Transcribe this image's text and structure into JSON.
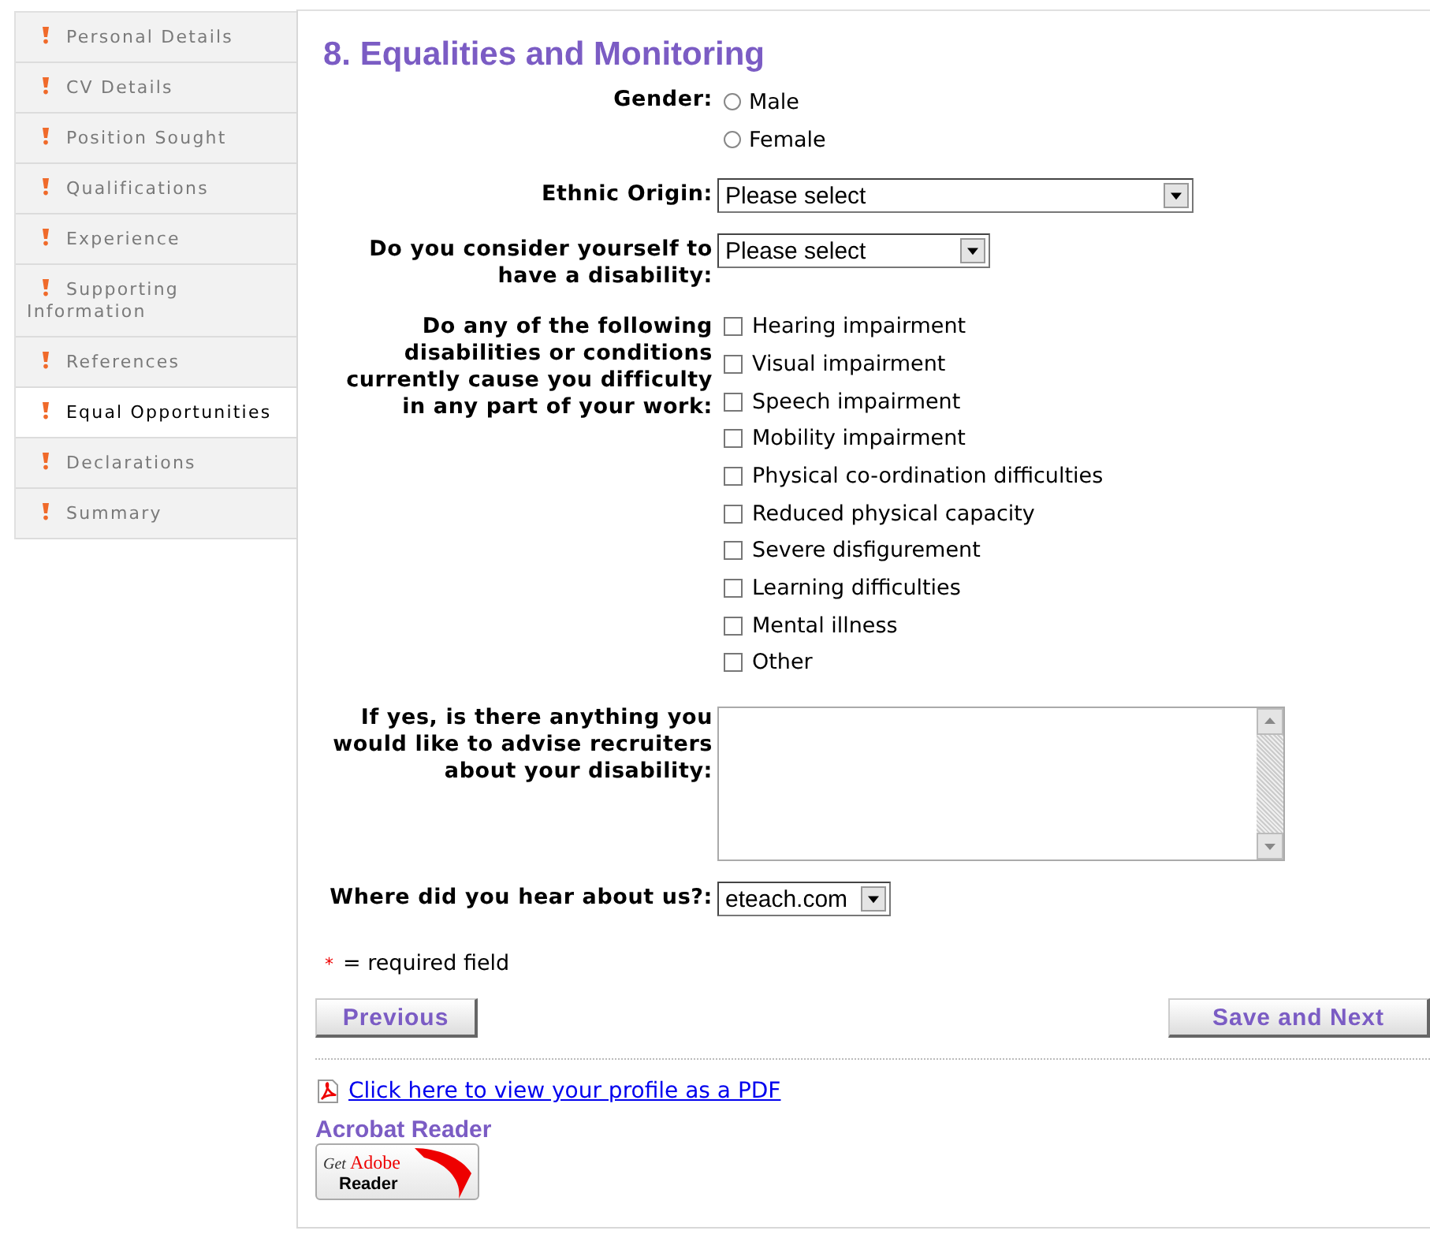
{
  "sidebar": {
    "items": [
      {
        "label": "Personal Details",
        "selected": false
      },
      {
        "label": "CV Details",
        "selected": false
      },
      {
        "label": "Position Sought",
        "selected": false
      },
      {
        "label": "Qualifications",
        "selected": false
      },
      {
        "label": "Experience",
        "selected": false
      },
      {
        "label": "Supporting Information",
        "selected": false
      },
      {
        "label": "References",
        "selected": false
      },
      {
        "label": "Equal Opportunities",
        "selected": true
      },
      {
        "label": "Declarations",
        "selected": false
      },
      {
        "label": "Summary",
        "selected": false
      }
    ]
  },
  "title": "8. Equalities and Monitoring",
  "fields": [
    {
      "kind": "radio",
      "label": "Gender:",
      "options": [
        {
          "label": "Male",
          "selected": false
        },
        {
          "label": "Female",
          "selected": false
        }
      ]
    },
    {
      "kind": "select",
      "label": "Ethnic Origin:",
      "value": "Please select"
    },
    {
      "kind": "select",
      "label": "Do you consider yourself to have a disability:",
      "value": "Please select"
    },
    {
      "kind": "checkboxes",
      "label": "Do any of the following disabilities or conditions currently cause you difficulty in any part of your work:",
      "options": [
        {
          "label": "Hearing impairment",
          "checked": false
        },
        {
          "label": "Visual impairment",
          "checked": false
        },
        {
          "label": "Speech impairment",
          "checked": false
        },
        {
          "label": "Mobility impairment",
          "checked": false
        },
        {
          "label": "Physical co-ordination difficulties",
          "checked": false
        },
        {
          "label": "Reduced physical capacity",
          "checked": false
        },
        {
          "label": "Severe disfigurement",
          "checked": false
        },
        {
          "label": "Learning difficulties",
          "checked": false
        },
        {
          "label": "Mental illness",
          "checked": false
        },
        {
          "label": "Other",
          "checked": false
        }
      ]
    },
    {
      "kind": "textarea",
      "label": "If yes, is there anything you would like to advise recruiters about your disability:"
    },
    {
      "kind": "select",
      "label": "Where did you hear about us?:",
      "value": "eteach.com"
    }
  ],
  "required_note": {
    "mark": "*",
    "text": "= required field"
  },
  "buttons": {
    "previous": "Previous",
    "next": "Save and Next"
  },
  "pdf_link": "Click here to view your profile as a PDF",
  "acrobat": {
    "heading": "Acrobat Reader",
    "badge_get": "Get",
    "badge_brand": "Adobe",
    "badge_product": "Reader"
  }
}
